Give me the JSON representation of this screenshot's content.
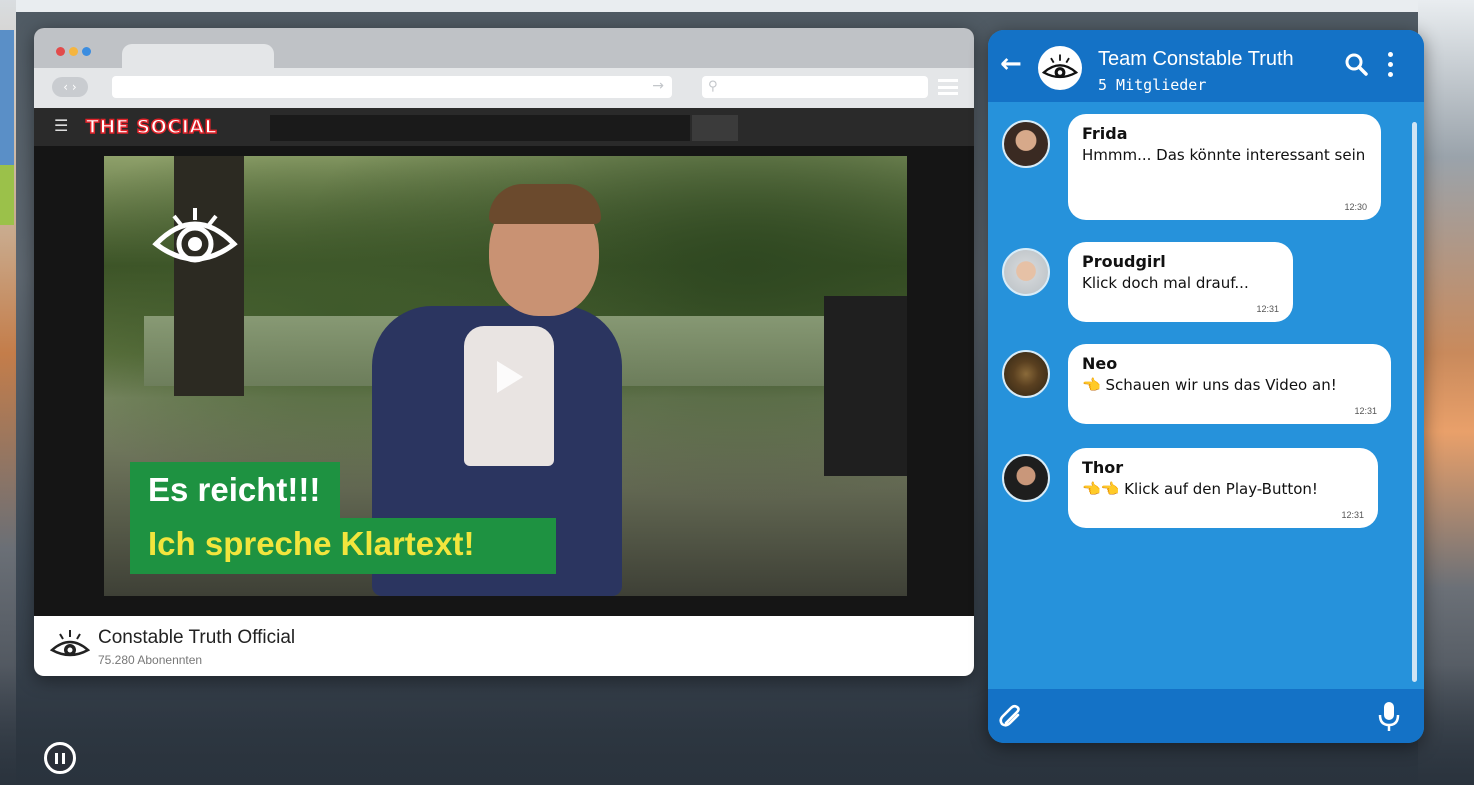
{
  "browser": {
    "traffic_lights": [
      "#e24b4b",
      "#f5b53f",
      "#3b8de0"
    ],
    "site": {
      "logo_text": "THE SOCIAL"
    },
    "video": {
      "caption_line1": "Es reicht!!!",
      "caption_line2": "Ich spreche Klartext!"
    },
    "channel": {
      "name": "Constable Truth Official",
      "subscribers": "75.280 Abonennten"
    }
  },
  "chat": {
    "header": {
      "title": "Team Constable Truth",
      "members": "5 Mitglieder"
    },
    "messages": [
      {
        "sender": "Frida",
        "text": "Hmmm... Das könnte interessant sein",
        "time": "12:30"
      },
      {
        "sender": "Proudgirl",
        "text": "Klick doch mal drauf...",
        "time": "12:31"
      },
      {
        "sender": "Neo",
        "hand": "👈",
        "text": "Schauen wir uns das Video an!",
        "time": "12:31"
      },
      {
        "sender": "Thor",
        "hand": "👈👈",
        "text": "Klick auf den Play-Button!",
        "time": "12:31"
      }
    ]
  },
  "colors": {
    "chat_blue": "#2692db",
    "chat_header": "#1472c6",
    "caption_green": "#1e9241",
    "caption_yellow": "#f2e53d",
    "logo_red": "#e0232a"
  }
}
